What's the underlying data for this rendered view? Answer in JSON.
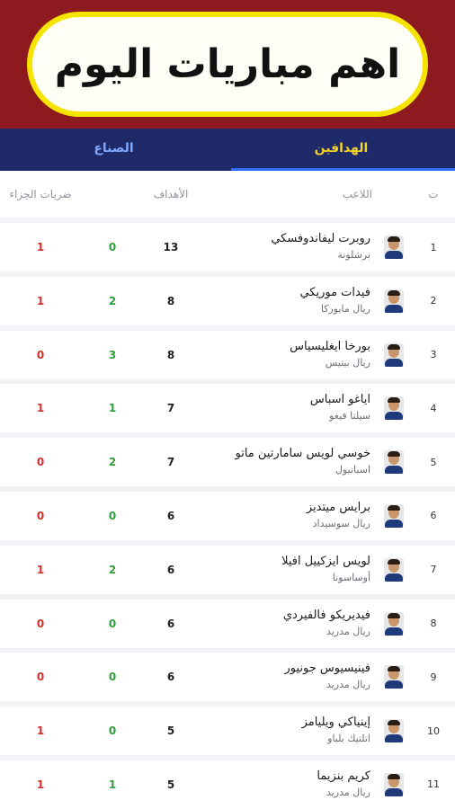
{
  "banner": {
    "title": "اهم مباريات اليوم"
  },
  "tabs": [
    {
      "label": "الهدافين",
      "active": true
    },
    {
      "label": "الصناع",
      "active": false
    }
  ],
  "header": {
    "rank": "ت",
    "player": "اللاعب",
    "goals": "الأهداف",
    "penalties": "ضربات الجزاء"
  },
  "players": [
    {
      "rank": "1",
      "name": "روبرت ليفاندوفسكي",
      "club": "برشلونة",
      "goals": "13",
      "assists": "0",
      "penalties": "1"
    },
    {
      "rank": "2",
      "name": "فيدات موريكي",
      "club": "ريال مايوركا",
      "goals": "8",
      "assists": "2",
      "penalties": "1"
    },
    {
      "rank": "3",
      "name": "بورخا ايغليسياس",
      "club": "ريال بيتيس",
      "goals": "8",
      "assists": "3",
      "penalties": "0"
    },
    {
      "rank": "4",
      "name": "اياغو اسباس",
      "club": "سيلتا فيغو",
      "goals": "7",
      "assists": "1",
      "penalties": "1"
    },
    {
      "rank": "5",
      "name": "خوسي لويس سامارتين ماتو",
      "club": "اسبانيول",
      "goals": "7",
      "assists": "2",
      "penalties": "0"
    },
    {
      "rank": "6",
      "name": "برايس ميتديز",
      "club": "ريال سوسيداد",
      "goals": "6",
      "assists": "0",
      "penalties": "0"
    },
    {
      "rank": "7",
      "name": "لويس ايزكييل افيلا",
      "club": "أوساسونا",
      "goals": "6",
      "assists": "2",
      "penalties": "1"
    },
    {
      "rank": "8",
      "name": "فيديريكو فالفيردي",
      "club": "ريال مدريد",
      "goals": "6",
      "assists": "0",
      "penalties": "0"
    },
    {
      "rank": "9",
      "name": "فينيسيوس جونيور",
      "club": "ريال مدريد",
      "goals": "6",
      "assists": "0",
      "penalties": "0"
    },
    {
      "rank": "10",
      "name": "إينياكي ويليامز",
      "club": "اتلتيك بلباو",
      "goals": "5",
      "assists": "0",
      "penalties": "1"
    },
    {
      "rank": "11",
      "name": "كريم بنزيما",
      "club": "ريال مدريد",
      "goals": "5",
      "assists": "1",
      "penalties": "1"
    }
  ],
  "colors": {
    "banner": "#8c1a1f",
    "tabs_bg": "#1f2a6b",
    "active_tab": "#f5d42a",
    "assists": "#2e9d3a",
    "penalties": "#d0312d"
  }
}
